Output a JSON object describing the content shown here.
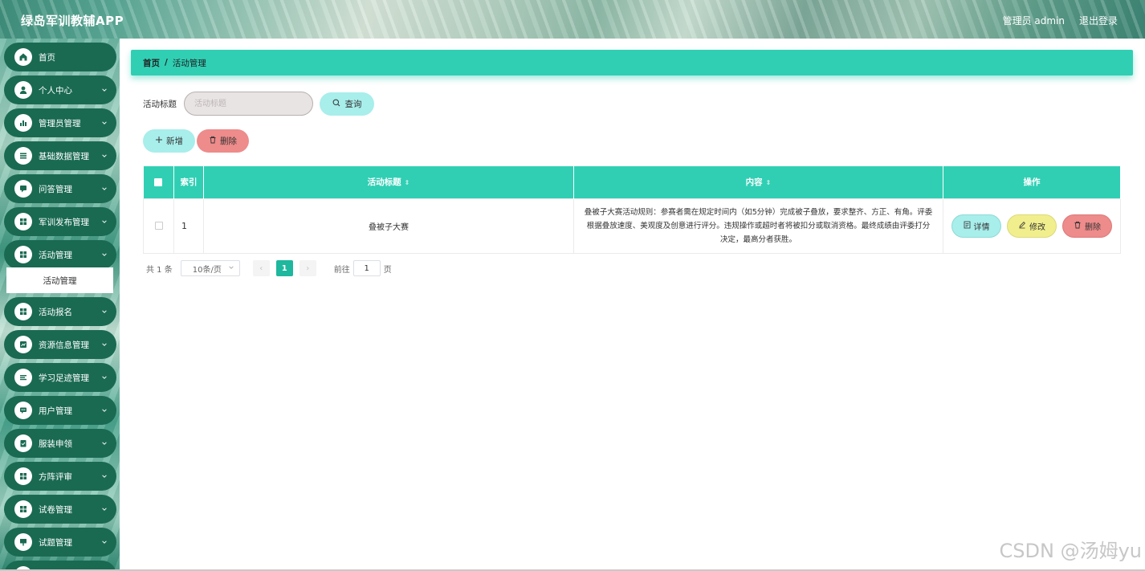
{
  "header": {
    "app_title": "绿岛军训教辅APP",
    "user_label": "管理员 admin",
    "logout_label": "退出登录"
  },
  "sidebar": {
    "items": [
      {
        "label": "首页",
        "icon": "home-icon"
      },
      {
        "label": "个人中心",
        "icon": "user-icon"
      },
      {
        "label": "管理员管理",
        "icon": "bar-chart-icon"
      },
      {
        "label": "基础数据管理",
        "icon": "list-icon"
      },
      {
        "label": "问答管理",
        "icon": "message-icon"
      },
      {
        "label": "军训发布管理",
        "icon": "grid-icon"
      },
      {
        "label": "活动管理",
        "icon": "grid-icon"
      },
      {
        "label": "活动报名",
        "icon": "grid-icon"
      },
      {
        "label": "资源信息管理",
        "icon": "chart-box-icon"
      },
      {
        "label": "学习足迹管理",
        "icon": "lines-icon"
      },
      {
        "label": "用户管理",
        "icon": "chat-icon"
      },
      {
        "label": "服装申领",
        "icon": "clipboard-icon"
      },
      {
        "label": "方阵评审",
        "icon": "grid-icon"
      },
      {
        "label": "试卷管理",
        "icon": "grid-icon"
      },
      {
        "label": "试题管理",
        "icon": "presentation-icon"
      }
    ],
    "sub_item": "活动管理"
  },
  "breadcrumb": {
    "home": "首页",
    "separator": "/",
    "current": "活动管理"
  },
  "search": {
    "label": "活动标题",
    "placeholder": "活动标题",
    "button_label": "查询"
  },
  "actions": {
    "add_label": "新增",
    "delete_label": "删除"
  },
  "table": {
    "columns": [
      "索引",
      "活动标题",
      "内容",
      "操作"
    ],
    "rows": [
      {
        "index": "1",
        "title": "叠被子大赛",
        "content": "叠被子大赛活动规则：参赛者需在规定时间内（如5分钟）完成被子叠放，要求整齐、方正、有角。评委根据叠放速度、美观度及创意进行评分。违规操作或超时者将被扣分或取消资格。最终成绩由评委打分决定，最高分者获胜。",
        "detail_label": "详情",
        "edit_label": "修改",
        "delete_label": "删除"
      }
    ]
  },
  "pagination": {
    "total": "共 1 条",
    "page_size": "10条/页",
    "current_page": "1",
    "goto_label": "前往",
    "goto_value": "1",
    "page_suffix": "页"
  },
  "watermark": "CSDN @汤姆yu",
  "colors": {
    "accent": "#30cfb4",
    "sidebar_item": "#1a6a52",
    "btn_cyan": "#a8eeeb",
    "btn_red": "#ee8b8b",
    "btn_yellow": "#f1ef8d"
  }
}
